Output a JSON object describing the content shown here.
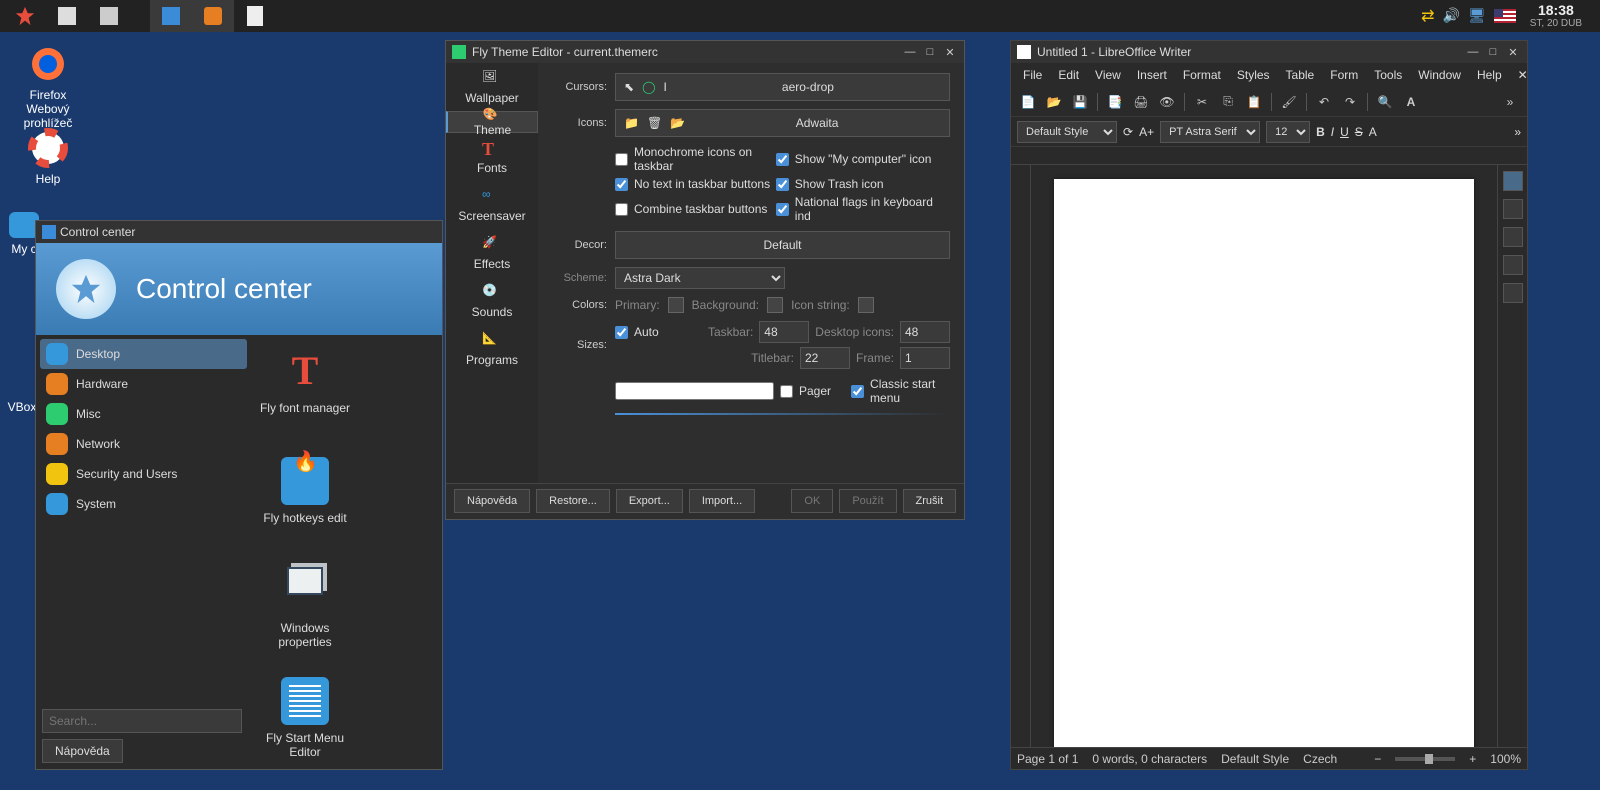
{
  "taskbar": {
    "clock_time": "18:38",
    "clock_date": "ST, 20 DUB"
  },
  "desktop": {
    "firefox": "Firefox Webový prohlížeč",
    "help": "Help",
    "mycomp": "My c",
    "vbox": "VBox"
  },
  "control_center": {
    "title": "Control center",
    "banner": "Control center",
    "categories": {
      "desktop": "Desktop",
      "hardware": "Hardware",
      "misc": "Misc",
      "network": "Network",
      "security": "Security and Users",
      "system": "System"
    },
    "tools": {
      "font": "Fly font manager",
      "hotkeys": "Fly hotkeys edit",
      "winprops": "Windows properties",
      "startmenu": "Fly Start Menu Editor"
    },
    "search_ph": "Search...",
    "help_btn": "Nápověda"
  },
  "theme_editor": {
    "title": "Fly Theme Editor - current.themerc",
    "tabs": {
      "wallpaper": "Wallpaper",
      "theme": "Theme",
      "fonts": "Fonts",
      "screensaver": "Screensaver",
      "effects": "Effects",
      "sounds": "Sounds",
      "programs": "Programs"
    },
    "labels": {
      "cursors": "Cursors:",
      "icons": "Icons:",
      "decor": "Decor:",
      "colors": "Colors:",
      "sizes": "Sizes:",
      "scheme": "Scheme:",
      "primary": "Primary:",
      "background": "Background:",
      "iconstring": "Icon string:",
      "taskbar": "Taskbar:",
      "desktop_icons": "Desktop  icons:",
      "titlebar": "Titlebar:",
      "frame": "Frame:"
    },
    "values": {
      "cursor": "aero-drop",
      "icons": "Adwaita",
      "decor": "Default",
      "scheme": "Astra Dark",
      "taskbar": "48",
      "desktop_icons": "48",
      "titlebar": "22",
      "frame": "1"
    },
    "checks": {
      "mono": "Monochrome icons on taskbar",
      "mycomp": "Show \"My computer\" icon",
      "notext": "No text in taskbar buttons",
      "trash": "Show Trash icon",
      "combine": "Combine taskbar buttons",
      "flags": "National flags in keyboard ind",
      "auto": "Auto",
      "pager": "Pager",
      "classic": "Classic start menu"
    },
    "buttons": {
      "help": "Nápověda",
      "restore": "Restore...",
      "export": "Export...",
      "import": "Import...",
      "ok": "OK",
      "apply": "Použít",
      "cancel": "Zrušit"
    }
  },
  "writer": {
    "title": "Untitled 1 - LibreOffice Writer",
    "menu": {
      "file": "File",
      "edit": "Edit",
      "view": "View",
      "insert": "Insert",
      "format": "Format",
      "styles": "Styles",
      "table": "Table",
      "form": "Form",
      "tools": "Tools",
      "window": "Window",
      "help": "Help"
    },
    "style": "Default Style",
    "font": "PT Astra Serif",
    "size": "12",
    "status": {
      "page": "Page 1 of 1",
      "words": "0 words, 0 characters",
      "style": "Default Style",
      "lang": "Czech",
      "zoom": "100%"
    }
  }
}
